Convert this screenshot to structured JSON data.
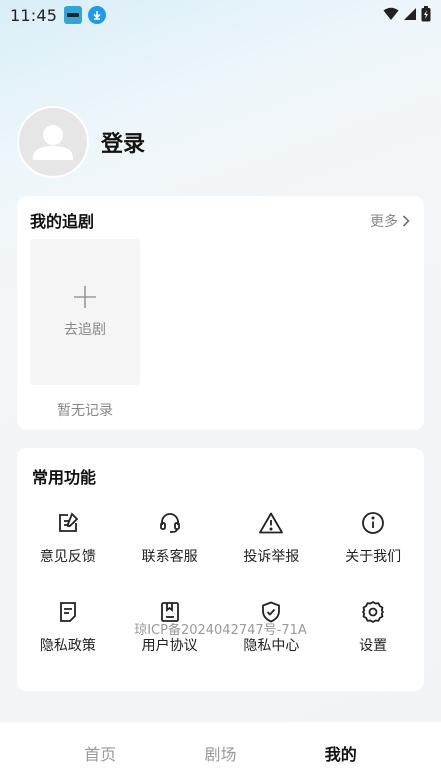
{
  "status_bar": {
    "time": "11:45",
    "icons": [
      "app-notification-icon",
      "download-icon",
      "wifi-icon",
      "signal-icon",
      "battery-icon"
    ]
  },
  "profile": {
    "login_label": "登录",
    "avatar_icon": "user-avatar-icon"
  },
  "my_dramas": {
    "title": "我的追剧",
    "more_label": "更多",
    "add_label": "去追剧",
    "empty_label": "暂无记录"
  },
  "functions": {
    "title": "常用功能",
    "items": [
      {
        "label": "意见反馈",
        "icon": "edit-feedback-icon"
      },
      {
        "label": "联系客服",
        "icon": "headset-icon"
      },
      {
        "label": "投诉举报",
        "icon": "warning-icon"
      },
      {
        "label": "关于我们",
        "icon": "info-icon"
      },
      {
        "label": "隐私政策",
        "icon": "document-icon"
      },
      {
        "label": "用户协议",
        "icon": "book-icon"
      },
      {
        "label": "隐私中心",
        "icon": "shield-icon"
      },
      {
        "label": "设置",
        "icon": "gear-icon"
      }
    ]
  },
  "icp": "琼ICP备2024042747号-71A",
  "tabbar": {
    "tabs": [
      {
        "label": "首页",
        "active": false
      },
      {
        "label": "剧场",
        "active": false
      },
      {
        "label": "我的",
        "active": true
      }
    ]
  },
  "colors": {
    "accent": "#111111",
    "muted": "#888888",
    "card": "#ffffff",
    "background": "#f2f3f5"
  }
}
